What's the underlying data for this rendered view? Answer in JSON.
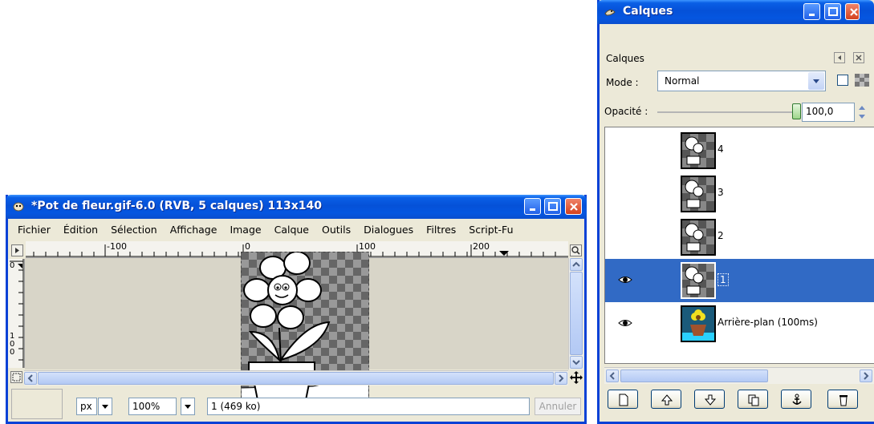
{
  "image_window": {
    "title": "*Pot de fleur.gif-6.0 (RVB, 5 calques) 113x140",
    "menu": [
      "Fichier",
      "Édition",
      "Sélection",
      "Affichage",
      "Image",
      "Calque",
      "Outils",
      "Dialogues",
      "Filtres",
      "Script-Fu"
    ],
    "ruler_h_labels": [
      "-100",
      "0",
      "100",
      "200"
    ],
    "ruler_v_labels": [
      "0",
      "100"
    ],
    "status": {
      "unit": "px",
      "zoom": "100%",
      "info": "1 (469 ko)",
      "cancel_label": "Annuler"
    }
  },
  "layers_window": {
    "title": "Calques",
    "header_label": "Calques",
    "mode_label": "Mode :",
    "mode_value": "Normal",
    "opacity_label": "Opacité :",
    "opacity_value": "100,0",
    "layers": [
      {
        "name": "4",
        "visible": false,
        "selected": false
      },
      {
        "name": "3",
        "visible": false,
        "selected": false
      },
      {
        "name": "2",
        "visible": false,
        "selected": false
      },
      {
        "name": "1",
        "visible": true,
        "selected": true
      },
      {
        "name": "Arrière-plan (100ms)",
        "visible": true,
        "selected": false
      }
    ],
    "buttons": [
      "new-layer-icon",
      "raise-layer-icon",
      "lower-layer-icon",
      "duplicate-layer-icon",
      "anchor-layer-icon",
      "delete-layer-icon"
    ]
  },
  "colors": {
    "xp_title": "#0551d8",
    "xp_face": "#ece9d8",
    "selection": "#316ac5"
  }
}
